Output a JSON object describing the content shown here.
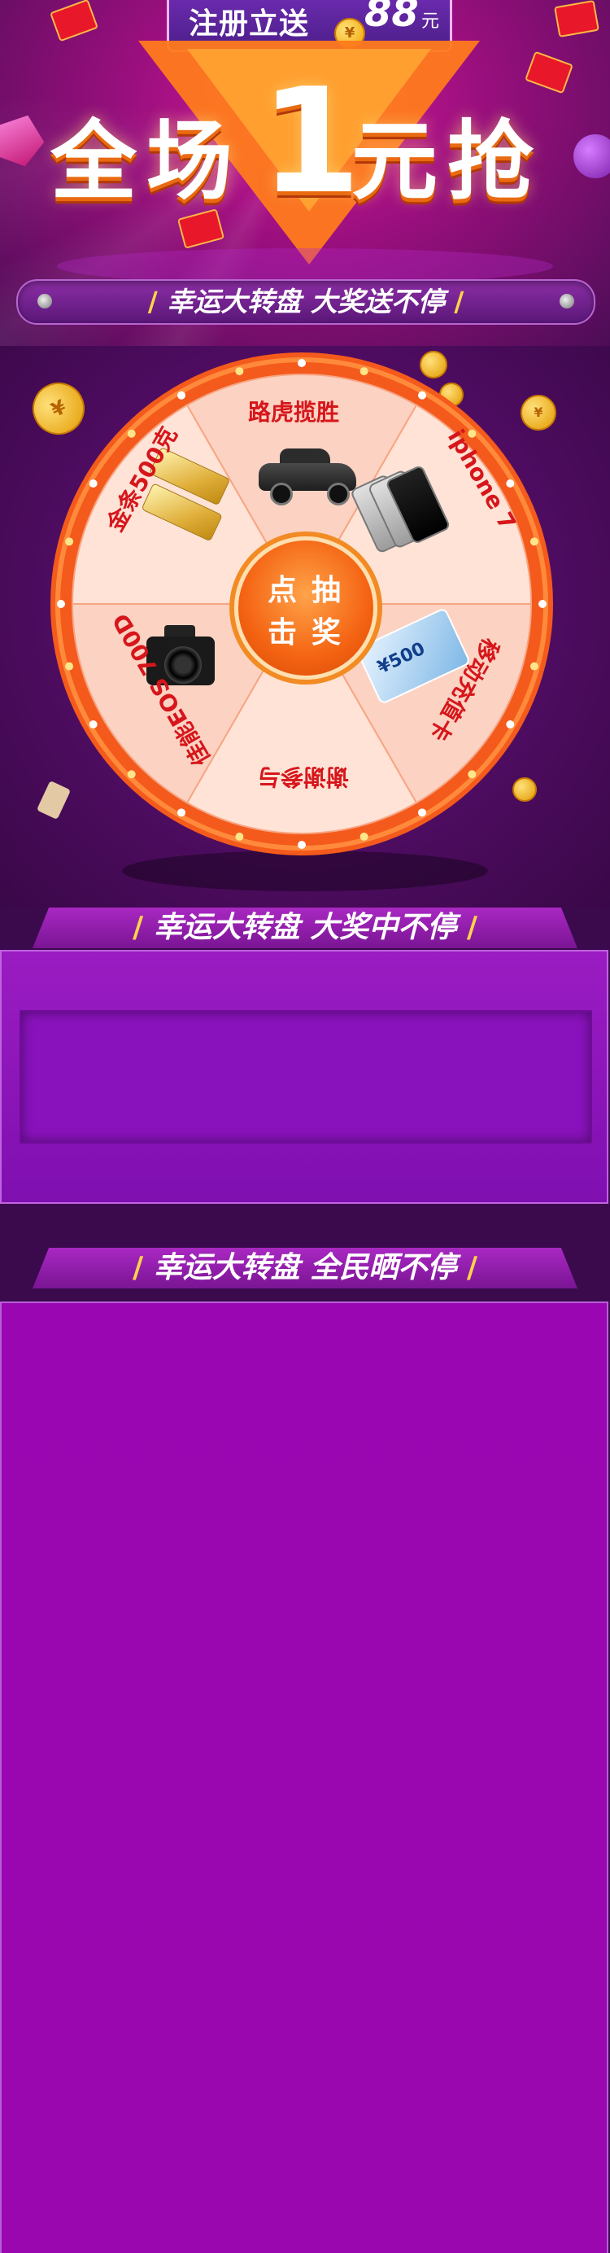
{
  "hero": {
    "register_text": "注册立送",
    "amount": "88",
    "unit": "元",
    "coin_symbol": "¥",
    "title_chars": [
      "全",
      "场",
      "1",
      "元",
      "抢"
    ],
    "slogan": "幸运大转盘  大奖送不停",
    "slash_left": "/",
    "slash_right": "/"
  },
  "wheel": {
    "prizes": {
      "top": "路虎揽胜",
      "iphone": "iphone 7",
      "card": "移动充值卡",
      "thanks": "谢谢参与",
      "canon": "佳能EOS 700D",
      "gold": "金条500克"
    },
    "card_amount": "¥500",
    "center_chars": [
      "点",
      "抽",
      "击",
      "奖"
    ],
    "coin_symbol": "¥"
  },
  "section2": {
    "title": "幸运大转盘  大奖中不停",
    "slash": "/"
  },
  "section3": {
    "title": "幸运大转盘  全民晒不停",
    "slash": "/"
  },
  "colors": {
    "brand_purple": "#9a07a8",
    "wheel_orange": "#f46312",
    "wheel_pink": "#fcd2c2",
    "prize_red": "#d6161b",
    "slash_gold": "#ffd44a"
  }
}
